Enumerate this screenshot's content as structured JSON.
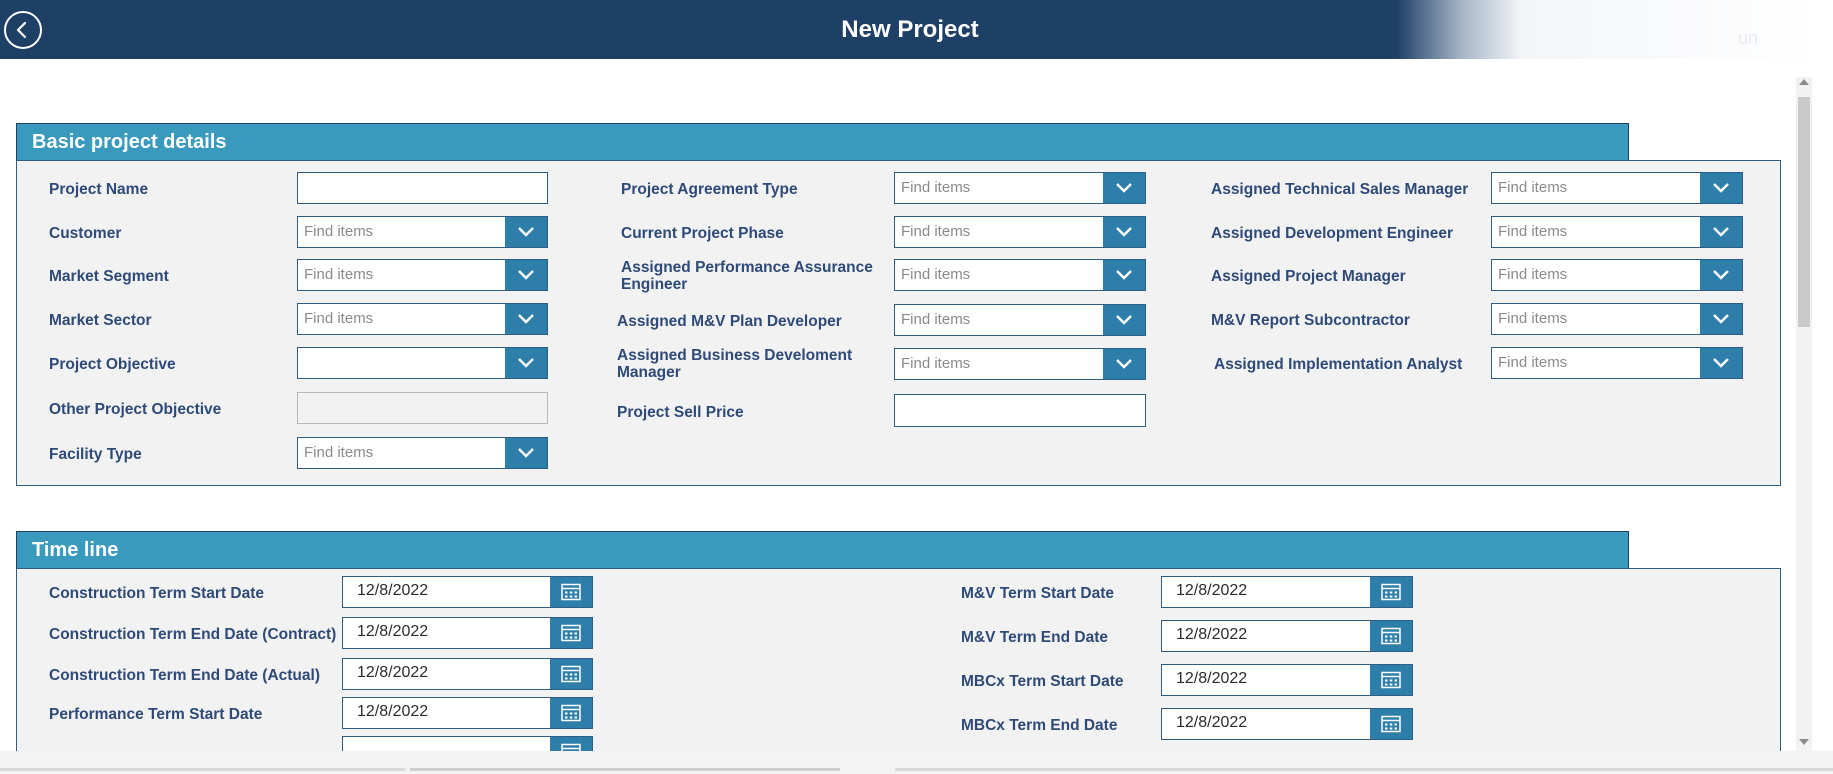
{
  "header": {
    "title": "New Project",
    "ghost_text": "un"
  },
  "colors": {
    "header_bg": "#1e3f66",
    "section_header_bg": "#3a9abe",
    "label_text": "#2e4a78",
    "dropdown_button": "#2d7fa9",
    "panel_bg": "#f2f2f2"
  },
  "icons": {
    "back": "back-arrow-icon",
    "refresh": "refresh-icon",
    "dropdown": "chevron-down-icon",
    "calendar": "calendar-icon"
  },
  "basic": {
    "heading": "Basic project details",
    "project_name": {
      "label": "Project Name",
      "value": ""
    },
    "customer": {
      "label": "Customer",
      "placeholder": "Find items"
    },
    "market_segment": {
      "label": "Market Segment",
      "placeholder": "Find items"
    },
    "market_sector": {
      "label": "Market Sector",
      "placeholder": "Find items"
    },
    "project_objective": {
      "label": "Project Objective",
      "placeholder": ""
    },
    "other_project_objective": {
      "label": "Other Project Objective",
      "value": ""
    },
    "facility_type": {
      "label": "Facility Type",
      "placeholder": "Find items"
    },
    "project_agreement_type": {
      "label": "Project Agreement Type",
      "placeholder": "Find items"
    },
    "current_project_phase": {
      "label": "Current Project Phase",
      "placeholder": "Find items"
    },
    "assigned_performance_assurance_engineer": {
      "label": "Assigned Performance Assurance Engineer",
      "placeholder": "Find items"
    },
    "assigned_mv_plan_developer": {
      "label": "Assigned M&V Plan Developer",
      "placeholder": "Find items"
    },
    "assigned_business_development_manager": {
      "label": "Assigned Business Develoment Manager",
      "placeholder": "Find items"
    },
    "project_sell_price": {
      "label": "Project Sell Price",
      "value": ""
    },
    "assigned_technical_sales_manager": {
      "label": "Assigned Technical Sales Manager",
      "placeholder": "Find items"
    },
    "assigned_development_engineer": {
      "label": "Assigned Development Engineer",
      "placeholder": "Find items"
    },
    "assigned_project_manager": {
      "label": "Assigned Project Manager",
      "placeholder": "Find items"
    },
    "mv_report_subcontractor": {
      "label": "M&V Report Subcontractor",
      "placeholder": "Find items"
    },
    "assigned_implementation_analyst": {
      "label": "Assigned Implementation Analyst",
      "placeholder": "Find items"
    }
  },
  "timeline": {
    "heading": "Time line",
    "construction_term_start_date": {
      "label": "Construction Term Start Date",
      "value": "12/8/2022"
    },
    "construction_term_end_date_contract": {
      "label": "Construction Term End Date (Contract)",
      "value": "12/8/2022"
    },
    "construction_term_end_date_actual": {
      "label": "Construction Term End Date (Actual)",
      "value": "12/8/2022"
    },
    "performance_term_start_date": {
      "label": "Performance Term Start Date",
      "value": "12/8/2022"
    },
    "mv_term_start_date": {
      "label": "M&V Term Start Date",
      "value": "12/8/2022"
    },
    "mv_term_end_date": {
      "label": "M&V Term End Date",
      "value": "12/8/2022"
    },
    "mbcx_term_start_date": {
      "label": "MBCx Term Start Date",
      "value": "12/8/2022"
    },
    "mbcx_term_end_date": {
      "label": "MBCx Term End Date",
      "value": "12/8/2022"
    }
  }
}
